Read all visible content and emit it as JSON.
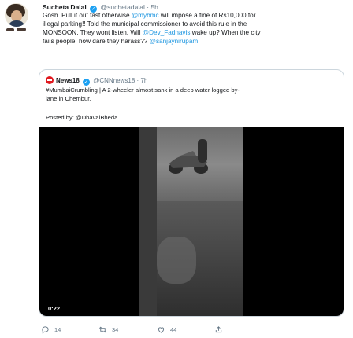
{
  "tweet": {
    "author_name": "Sucheta Dalal",
    "handle": "@suchetadalal",
    "separator": "·",
    "time": "5h",
    "text_lines": [
      [
        {
          "t": "Gosh. Pull it out fast otherwise "
        },
        {
          "t": "@mybmc",
          "m": true
        },
        {
          "t": " will impose a fine of Rs10,000 for"
        }
      ],
      [
        {
          "t": "illegal parking!! Told the municipal commissioner to avoid this rule in the"
        }
      ],
      [
        {
          "t": "MONSOON. They wont listen. Will "
        },
        {
          "t": "@Dev_Fadnavis",
          "m": true
        },
        {
          "t": " wake up? When the city"
        }
      ],
      [
        {
          "t": "fails people, how dare they harass?? "
        },
        {
          "t": "@sanjaynirupam",
          "m": true
        }
      ]
    ]
  },
  "quote": {
    "author_name": "News18",
    "handle": "@CNNnews18",
    "separator": "·",
    "time": "7h",
    "text_lines": [
      [
        {
          "t": "#MumbaiCrumbling | A 2-wheeler almost sank in a deep water logged by-"
        }
      ],
      [
        {
          "t": "lane in Chembur."
        }
      ]
    ],
    "posted_by": "Posted by: @DhavalBheda",
    "video": {
      "duration": "0:22"
    }
  },
  "actions": {
    "reply_count": "14",
    "retweet_count": "34",
    "like_count": "44"
  },
  "colors": {
    "link": "#1b95e0",
    "verified": "#1da1f2",
    "news18_red": "#e0191f",
    "muted": "#657786"
  },
  "icons": [
    "reply-icon",
    "retweet-icon",
    "like-icon",
    "share-icon",
    "verified-icon",
    "news18-logo"
  ]
}
